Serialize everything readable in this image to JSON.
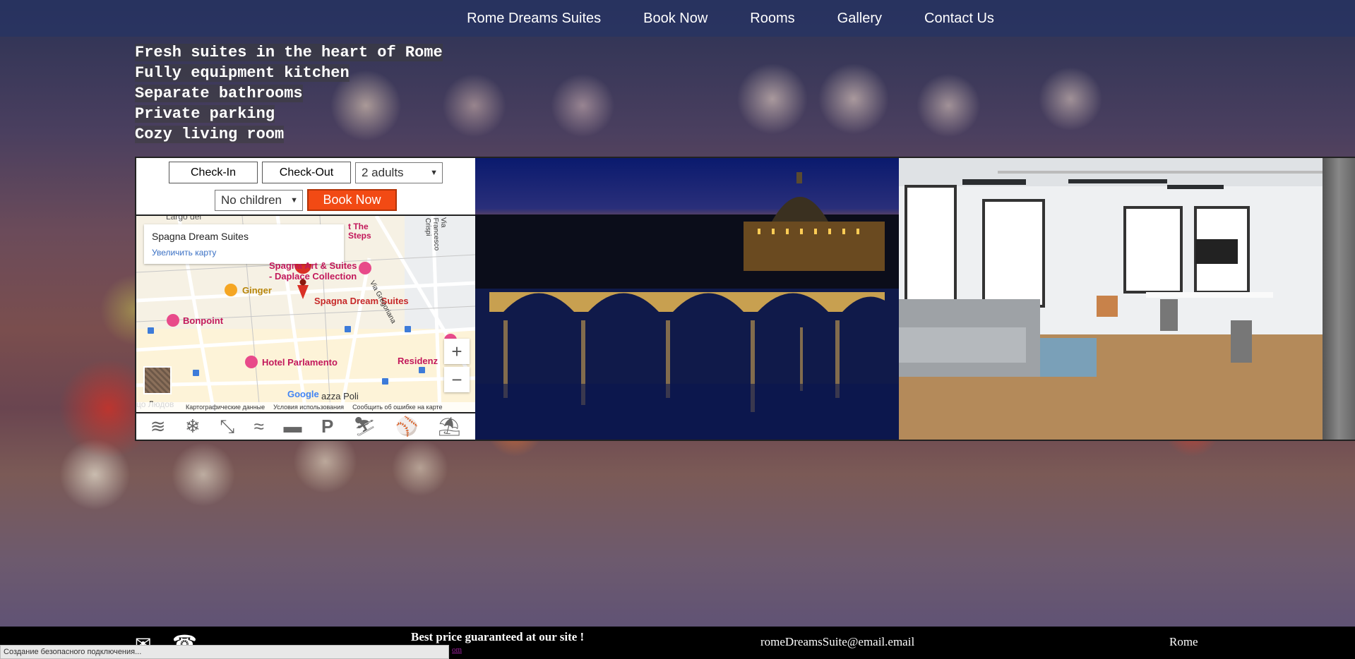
{
  "nav": {
    "brand": "Rome Dreams Suites",
    "book_now": "Book Now",
    "rooms": "Rooms",
    "gallery": "Gallery",
    "contact_us": "Contact Us"
  },
  "features": [
    "Fresh suites in the heart of Rome",
    "Fully equipment kitchen",
    "Separate bathrooms",
    "Private parking",
    "Cozy living room"
  ],
  "booking": {
    "check_in": "Check-In",
    "check_out": "Check-Out",
    "adults": "2 adults",
    "children": "No children",
    "book_now": "Book Now"
  },
  "map": {
    "place_title": "Spagna Dream Suites",
    "enlarge_link": "Увеличить карту",
    "labels": {
      "largo": "Largo del",
      "the_steps_1": "t The",
      "the_steps_2": "Steps",
      "spagna_art": "Spagna Art & Suites",
      "daplace": "- Daplace Collection",
      "ginger": "Ginger",
      "pin_label": "Spagna Dream Suites",
      "bonpoint": "Bonpoint",
      "hotel_parlamento": "Hotel Parlamento",
      "residenza": "Residenz",
      "piazza_poli": "azza Poli",
      "via_gregoriana": "Via Gregoriana",
      "via_crispi": "Via Francesco Crispi",
      "lyudov": "цо Людов"
    },
    "zoom_in": "+",
    "zoom_out": "−",
    "footer": {
      "google": "Google",
      "map_data": "Картографические данные",
      "terms": "Условия использования",
      "report": "Сообщить об ошибке на карте"
    }
  },
  "amenities": [
    "wifi-icon",
    "snowflake-icon",
    "resize-icon",
    "swim-icon",
    "credit-card-icon",
    "parking-icon",
    "ski-icon",
    "pool-icon",
    "beach-umbrella-icon"
  ],
  "amenity_glyphs": [
    "≋",
    "❄",
    "⤡",
    "≈",
    "▬",
    "P",
    "⛷",
    "⚾",
    "⛱"
  ],
  "footer": {
    "tagline": "Best price guaranteed at our site !",
    "link_fragment": "om",
    "email": "romeDreamsSuite@email.email",
    "city": "Rome"
  },
  "status_bar": "Создание безопасного подключения..."
}
